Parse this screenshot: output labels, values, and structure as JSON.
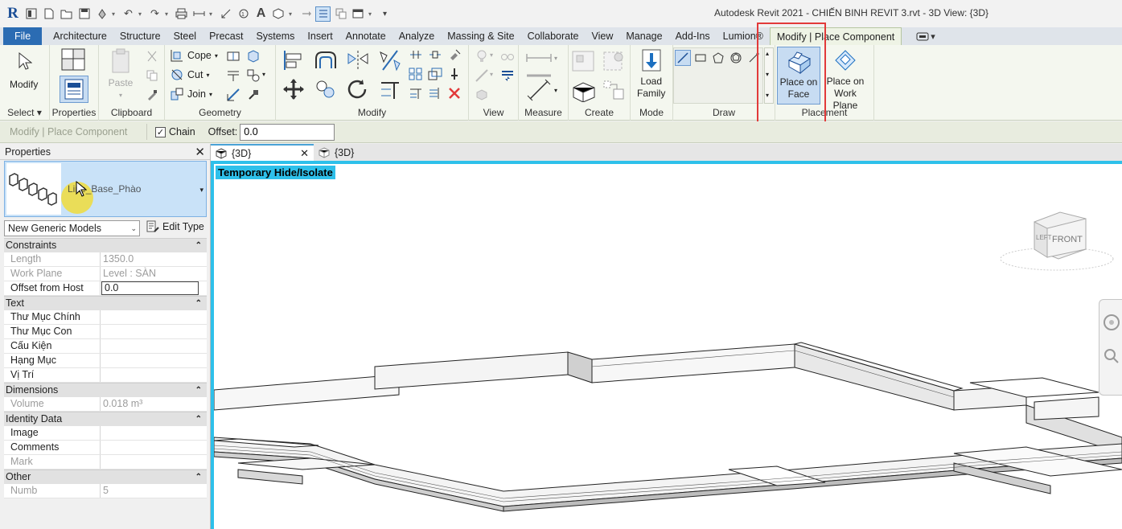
{
  "window": {
    "title": "Autodesk Revit 2021 - CHIẾN BINH REVIT 3.rvt - 3D View: {3D}"
  },
  "menu_tabs": [
    "File",
    "Architecture",
    "Structure",
    "Steel",
    "Precast",
    "Systems",
    "Insert",
    "Annotate",
    "Analyze",
    "Massing & Site",
    "Collaborate",
    "View",
    "Manage",
    "Add-Ins",
    "Lumion®",
    "Modify | Place Component"
  ],
  "ribbon": {
    "select": {
      "modify_label": "Modify",
      "panel_label": "Select ▾"
    },
    "properties": {
      "panel_label": "Properties"
    },
    "clipboard": {
      "paste_label": "Paste",
      "panel_label": "Clipboard"
    },
    "geometry": {
      "cope_label": "Cope",
      "cut_label": "Cut",
      "join_label": "Join",
      "panel_label": "Geometry"
    },
    "modify": {
      "panel_label": "Modify"
    },
    "view": {
      "panel_label": "View"
    },
    "measure": {
      "panel_label": "Measure"
    },
    "create": {
      "panel_label": "Create"
    },
    "mode": {
      "load_family_line1": "Load",
      "load_family_line2": "Family",
      "panel_label": "Mode"
    },
    "draw": {
      "panel_label": "Draw"
    },
    "placement": {
      "place_on_face_line1": "Place on",
      "place_on_face_line2": "Face",
      "place_on_work_plane_line1": "Place on",
      "place_on_work_plane_line2": "Work Plane",
      "panel_label": "Placement"
    }
  },
  "options_bar": {
    "context": "Modify | Place Component",
    "chain_label": "Chain",
    "chain_checked": true,
    "offset_label": "Offset:",
    "offset_value": "0.0"
  },
  "properties": {
    "title": "Properties",
    "type_name": "Line_Base_Phào",
    "instance_filter": "New Generic Models",
    "edit_type_label": "Edit Type",
    "categories": [
      {
        "name": "Constraints",
        "rows": [
          {
            "key": "Length",
            "value": "1350.0",
            "readonly": true
          },
          {
            "key": "Work Plane",
            "value": "Level : SÀN",
            "readonly": true
          },
          {
            "key": "Offset from Host",
            "value": "0.0",
            "readonly": false,
            "editing": true
          }
        ]
      },
      {
        "name": "Text",
        "rows": [
          {
            "key": "Thư Mục Chính",
            "value": "",
            "readonly": false
          },
          {
            "key": "Thư Mục Con",
            "value": "",
            "readonly": false
          },
          {
            "key": "Cấu Kiện",
            "value": "",
            "readonly": false
          },
          {
            "key": "Hạng Mục",
            "value": "",
            "readonly": false
          },
          {
            "key": "Vị Trí",
            "value": "",
            "readonly": false
          }
        ]
      },
      {
        "name": "Dimensions",
        "rows": [
          {
            "key": "Volume",
            "value": "0.018 m³",
            "readonly": true
          }
        ]
      },
      {
        "name": "Identity Data",
        "rows": [
          {
            "key": "Image",
            "value": "",
            "readonly": false
          },
          {
            "key": "Comments",
            "value": "",
            "readonly": false
          },
          {
            "key": "Mark",
            "value": "",
            "readonly": true
          }
        ]
      },
      {
        "name": "Other",
        "rows": [
          {
            "key": "Numb",
            "value": "5",
            "readonly": true
          }
        ]
      }
    ]
  },
  "view_tabs": [
    "{3D}",
    "{3D}"
  ],
  "viewport": {
    "temp_hide_badge": "Temporary Hide/Isolate",
    "viewcube_front": "FRONT",
    "viewcube_left": "LEFT"
  },
  "colors": {
    "file_tab": "#2b6cb3",
    "highlight_box": "#e23a3a",
    "viewport_border": "#2ec0ea",
    "selected_button": "#c7dcf2"
  }
}
